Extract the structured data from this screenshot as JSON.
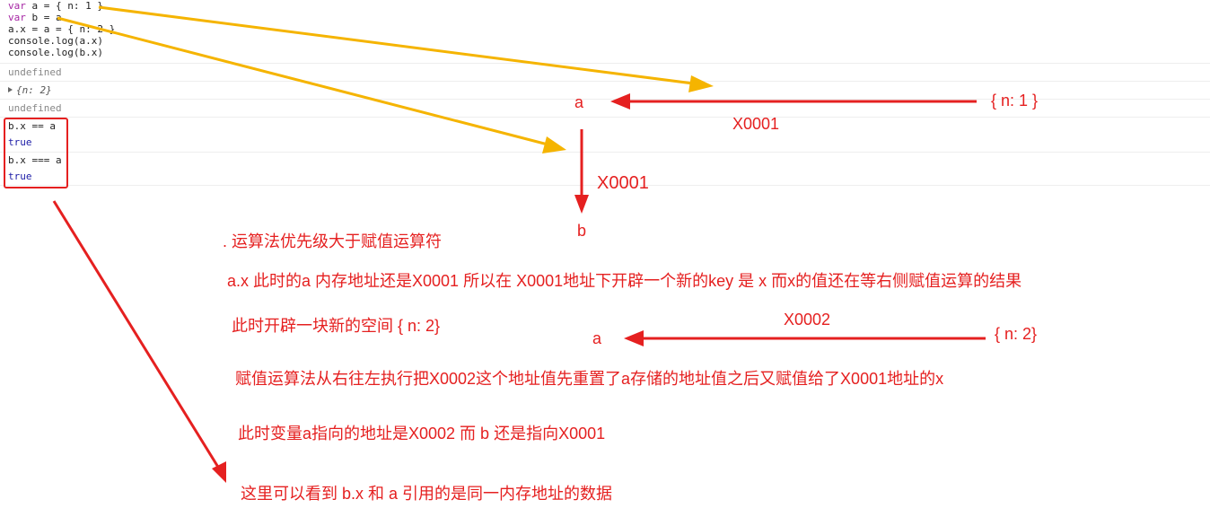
{
  "console": {
    "code_lines": [
      {
        "kw": "var",
        "rest": " a = { n: 1 }"
      },
      {
        "kw": "var",
        "rest": " b = a"
      },
      {
        "kw": "",
        "rest": "a.x = a = { n: 2 }"
      },
      {
        "kw": "",
        "rest": "console.log(a.x)"
      },
      {
        "kw": "",
        "rest": "console.log(b.x)"
      }
    ],
    "output_undefined_1": "undefined",
    "output_object": "{n: 2}",
    "output_undefined_2": "undefined",
    "check_1_expr": "b.x == a",
    "check_1_result": "true",
    "check_2_expr": "b.x === a",
    "check_2_result": "true"
  },
  "annotations": {
    "label_a_top": "a",
    "label_obj1": "{ n: 1 }",
    "label_addr1_h": "X0001",
    "label_addr1_v": "X0001",
    "label_b": "b",
    "note_1": ". 运算法优先级大于赋值运算符",
    "note_2": "a.x 此时的a 内存地址还是X0001 所以在 X0001地址下开辟一个新的key  是 x 而x的值还在等右侧赋值运算的结果",
    "note_3": "此时开辟一块新的空间 { n: 2}",
    "label_addr2": "X0002",
    "label_a_mid": "a",
    "label_obj2": "{ n: 2}",
    "note_4": "赋值运算法从右往左执行把X0002这个地址值先重置了a存储的地址值之后又赋值给了X0001地址的x",
    "note_5": "此时变量a指向的地址是X0002  而 b 还是指向X0001",
    "note_6": "这里可以看到  b.x  和 a 引用的是同一内存地址的数据"
  },
  "colors": {
    "annotation_red": "#e52020",
    "arrow_yellow": "#f5b400"
  }
}
